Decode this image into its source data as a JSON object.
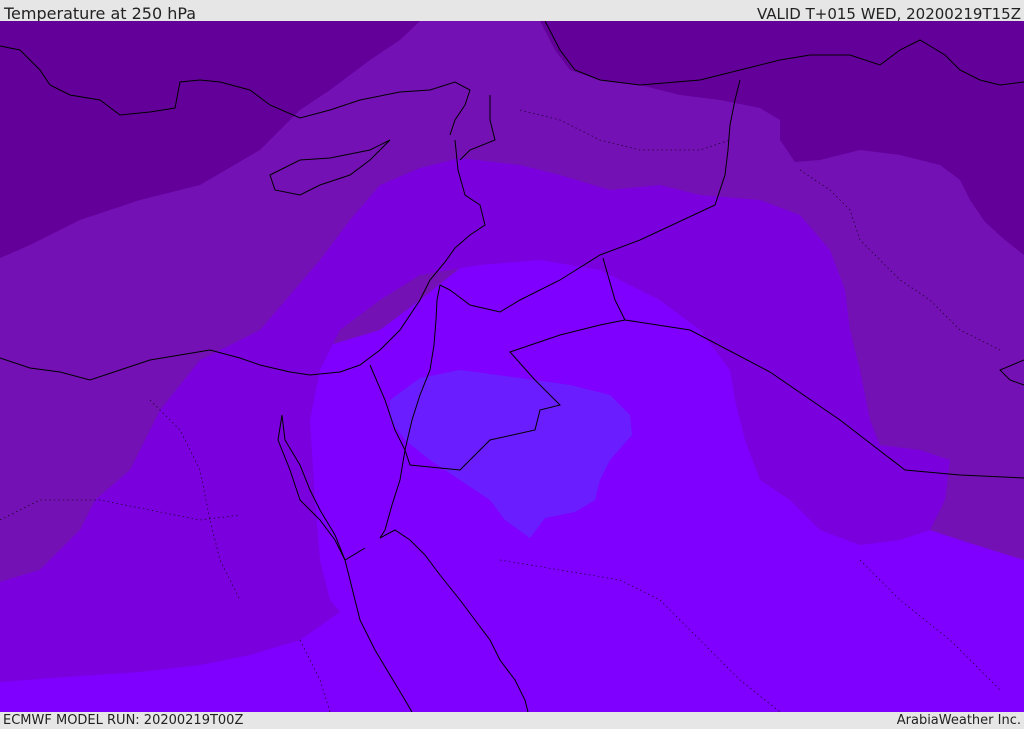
{
  "header": {
    "title": "Temperature at 250 hPa",
    "valid_time": "VALID T+015 WED, 20200219T15Z"
  },
  "footer": {
    "model_run": "ECMWF MODEL RUN: 20200219T00Z",
    "credit": "ArabiaWeather Inc."
  },
  "map": {
    "colors": {
      "band_coldest": "#63009a",
      "band_cold": "#7411b4",
      "band_mid": "#7a00dd",
      "band_warm": "#7f00ff",
      "band_warmest": "#6a1eff",
      "outline": "#000000"
    }
  }
}
